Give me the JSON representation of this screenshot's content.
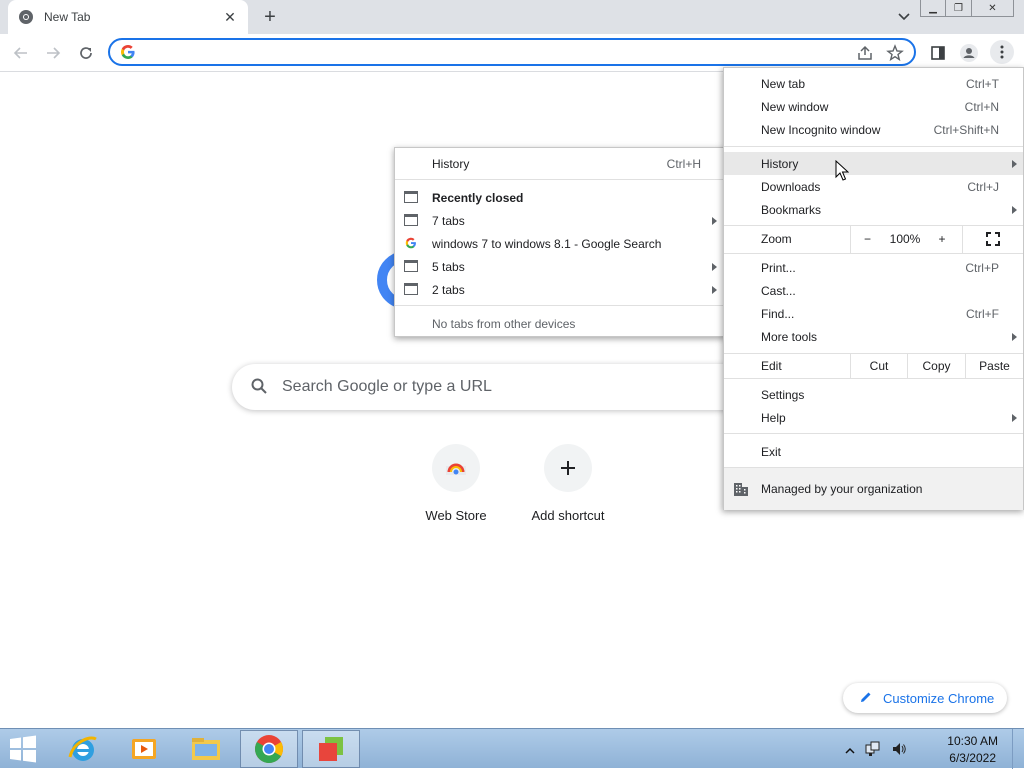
{
  "tab": {
    "title": "New Tab"
  },
  "page": {
    "search_placeholder": "Search Google or type a URL",
    "shortcuts": [
      {
        "label": "Web Store"
      },
      {
        "label": "Add shortcut"
      }
    ],
    "customize_label": "Customize Chrome"
  },
  "menu": {
    "new_tab": {
      "label": "New tab",
      "shortcut": "Ctrl+T"
    },
    "new_window": {
      "label": "New window",
      "shortcut": "Ctrl+N"
    },
    "new_incognito": {
      "label": "New Incognito window",
      "shortcut": "Ctrl+Shift+N"
    },
    "history": {
      "label": "History"
    },
    "downloads": {
      "label": "Downloads",
      "shortcut": "Ctrl+J"
    },
    "bookmarks": {
      "label": "Bookmarks"
    },
    "zoom": {
      "label": "Zoom",
      "minus": "−",
      "value": "100%",
      "plus": "+"
    },
    "print": {
      "label": "Print...",
      "shortcut": "Ctrl+P"
    },
    "cast": {
      "label": "Cast..."
    },
    "find": {
      "label": "Find...",
      "shortcut": "Ctrl+F"
    },
    "more_tools": {
      "label": "More tools"
    },
    "edit": {
      "label": "Edit",
      "cut": "Cut",
      "copy": "Copy",
      "paste": "Paste"
    },
    "settings": {
      "label": "Settings"
    },
    "help": {
      "label": "Help"
    },
    "exit": {
      "label": "Exit"
    },
    "managed": {
      "label": "Managed by your organization"
    }
  },
  "history_submenu": {
    "history": {
      "label": "History",
      "shortcut": "Ctrl+H"
    },
    "recently_closed": "Recently closed",
    "items": [
      {
        "label": "7 tabs"
      },
      {
        "label": "windows 7 to windows 8.1 - Google Search"
      },
      {
        "label": "5 tabs"
      },
      {
        "label": "2 tabs"
      }
    ],
    "no_tabs": "No tabs from other devices"
  },
  "taskbar": {
    "time": "10:30 AM",
    "date": "6/3/2022"
  }
}
